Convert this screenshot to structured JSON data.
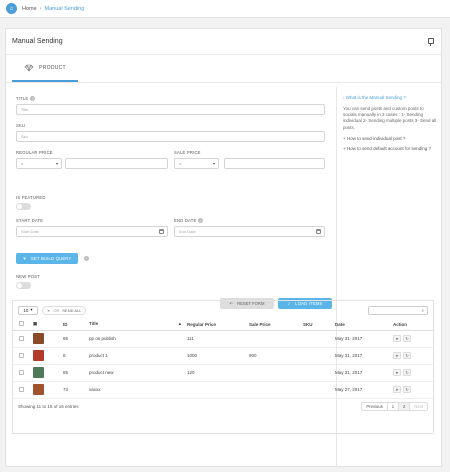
{
  "breadcrumb": {
    "home": "Home",
    "sep": "›",
    "current": "Manual Sending"
  },
  "panel": {
    "title": "Manual Sending"
  },
  "tabs": [
    {
      "label": "PRODUCT"
    }
  ],
  "form": {
    "title": {
      "label": "TITLE",
      "placeholder": "Title"
    },
    "sku": {
      "label": "SKU",
      "placeholder": "Sku"
    },
    "regular_price": {
      "label": "REGULAR PRICE",
      "op": "="
    },
    "sale_price": {
      "label": "SALE PRICE",
      "op": "="
    },
    "is_featured": {
      "label": "IS FEATURED"
    },
    "start_date": {
      "label": "START DATE",
      "placeholder": "Start Date"
    },
    "end_date": {
      "label": "END DATE",
      "placeholder": "End Date"
    },
    "set_build_query": "SET BUILD QUERY",
    "new_post": {
      "label": "NEW POST"
    },
    "reset": "RESET FORM",
    "load": "LOAD ITEMS"
  },
  "side": {
    "heading": "What is the Manual Sending ?",
    "text": "You can send posts and custom posts to socials manually in 3 cases : 1- Sending individual 2- Sending multiple posts 3- Send all posts.",
    "links": [
      "How to send individual post ?",
      "How to send default account for sending ?"
    ]
  },
  "table": {
    "page_size": "10",
    "send_or": "OR",
    "send_all": "SEND ALL",
    "columns": [
      "ID",
      "Title",
      "Regular Price",
      "Sale Price",
      "SKU",
      "Date",
      "Action"
    ],
    "rows": [
      {
        "id": "86",
        "title": "pp on publish",
        "regular": "111",
        "sale": "",
        "sku": "",
        "date": "May 31, 2017",
        "thumb": "#8a4a2a"
      },
      {
        "id": "8",
        "title": "product 1",
        "regular": "1000",
        "sale": "900",
        "sku": "",
        "date": "May 31, 2017",
        "thumb": "#b23a2a"
      },
      {
        "id": "85",
        "title": "product new",
        "regular": "120",
        "sale": "",
        "sku": "",
        "date": "May 31, 2017",
        "thumb": "#4e7a5a"
      },
      {
        "id": "73",
        "title": "vaxxx",
        "regular": "",
        "sale": "",
        "sku": "",
        "date": "May 27, 2017",
        "thumb": "#a0522d"
      }
    ],
    "info": "Showing 11 to 16 of 16 entries",
    "pager": {
      "prev": "Previous",
      "p1": "1",
      "p2": "2",
      "next": "Next"
    }
  },
  "colors": {
    "accent": "#4a9fd8",
    "button": "#5bb5e8"
  }
}
